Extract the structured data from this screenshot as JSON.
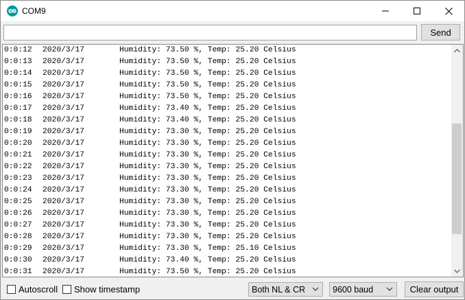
{
  "window": {
    "title": "COM9",
    "app_icon": "arduino-logo-icon"
  },
  "send_bar": {
    "input_value": "",
    "input_placeholder": "",
    "send_label": "Send"
  },
  "output": {
    "lines": [
      {
        "time": "0:0:12",
        "date": "2020/3/17",
        "message": "Humidity: 73.50 %, Temp: 25.20 Celsius"
      },
      {
        "time": "0:0:13",
        "date": "2020/3/17",
        "message": "Humidity: 73.50 %, Temp: 25.20 Celsius"
      },
      {
        "time": "0:0:14",
        "date": "2020/3/17",
        "message": "Humidity: 73.50 %, Temp: 25.20 Celsius"
      },
      {
        "time": "0:0:15",
        "date": "2020/3/17",
        "message": "Humidity: 73.50 %, Temp: 25.20 Celsius"
      },
      {
        "time": "0:0:16",
        "date": "2020/3/17",
        "message": "Humidity: 73.50 %, Temp: 25.20 Celsius"
      },
      {
        "time": "0:0:17",
        "date": "2020/3/17",
        "message": "Humidity: 73.40 %, Temp: 25.20 Celsius"
      },
      {
        "time": "0:0:18",
        "date": "2020/3/17",
        "message": "Humidity: 73.40 %, Temp: 25.20 Celsius"
      },
      {
        "time": "0:0:19",
        "date": "2020/3/17",
        "message": "Humidity: 73.30 %, Temp: 25.20 Celsius"
      },
      {
        "time": "0:0:20",
        "date": "2020/3/17",
        "message": "Humidity: 73.30 %, Temp: 25.20 Celsius"
      },
      {
        "time": "0:0:21",
        "date": "2020/3/17",
        "message": "Humidity: 73.30 %, Temp: 25.20 Celsius"
      },
      {
        "time": "0:0:22",
        "date": "2020/3/17",
        "message": "Humidity: 73.30 %, Temp: 25.20 Celsius"
      },
      {
        "time": "0:0:23",
        "date": "2020/3/17",
        "message": "Humidity: 73.30 %, Temp: 25.20 Celsius"
      },
      {
        "time": "0:0:24",
        "date": "2020/3/17",
        "message": "Humidity: 73.30 %, Temp: 25.20 Celsius"
      },
      {
        "time": "0:0:25",
        "date": "2020/3/17",
        "message": "Humidity: 73.30 %, Temp: 25.20 Celsius"
      },
      {
        "time": "0:0:26",
        "date": "2020/3/17",
        "message": "Humidity: 73.30 %, Temp: 25.20 Celsius"
      },
      {
        "time": "0:0:27",
        "date": "2020/3/17",
        "message": "Humidity: 73.30 %, Temp: 25.20 Celsius"
      },
      {
        "time": "0:0:28",
        "date": "2020/3/17",
        "message": "Humidity: 73.30 %, Temp: 25.20 Celsius"
      },
      {
        "time": "0:0:29",
        "date": "2020/3/17",
        "message": "Humidity: 73.30 %, Temp: 25.10 Celsius"
      },
      {
        "time": "0:0:30",
        "date": "2020/3/17",
        "message": "Humidity: 73.40 %, Temp: 25.20 Celsius"
      },
      {
        "time": "0:0:31",
        "date": "2020/3/17",
        "message": "Humidity: 73.50 %, Temp: 25.20 Celsius"
      }
    ]
  },
  "bottom_bar": {
    "autoscroll_label": "Autoscroll",
    "autoscroll_checked": false,
    "timestamp_label": "Show timestamp",
    "timestamp_checked": false,
    "line_ending_value": "Both NL & CR",
    "baud_value": "9600 baud",
    "clear_label": "Clear output"
  },
  "colors": {
    "arduino_teal": "#00979c",
    "scroll_thumb": "#cdcdcd"
  }
}
